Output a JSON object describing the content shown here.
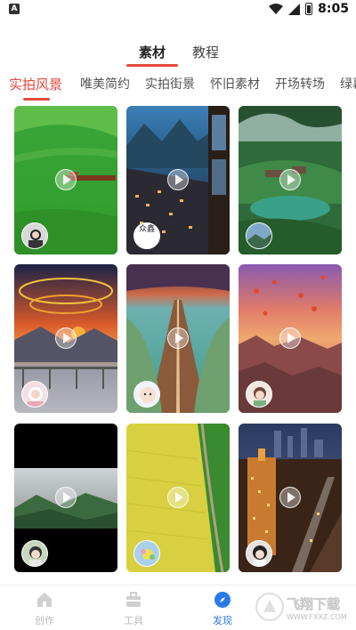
{
  "status": {
    "app_icon": "A",
    "time": "8:05"
  },
  "top_tabs": [
    {
      "label": "素材",
      "active": true
    },
    {
      "label": "教程",
      "active": false
    }
  ],
  "category_tabs": [
    {
      "label": "实拍风景",
      "active": true
    },
    {
      "label": "唯美简约"
    },
    {
      "label": "实拍街景"
    },
    {
      "label": "怀旧素材"
    },
    {
      "label": "开场转场"
    },
    {
      "label": "绿幕"
    }
  ],
  "cards": [
    {
      "thumb": "green-meadow-with-train",
      "avatar": "girl-portrait-avatar"
    },
    {
      "thumb": "mountain-town-night",
      "avatar_text": "众鑫"
    },
    {
      "thumb": "lush-valley-pools",
      "avatar": "small-landscape-avatar"
    },
    {
      "thumb": "sunset-swirl-sky",
      "avatar": "anime-girl-avatar"
    },
    {
      "thumb": "long-road-across-lake",
      "avatar": "cartoon-avatar"
    },
    {
      "thumb": "hot-air-balloons-canyon",
      "avatar": "cartoon-girl-avatar"
    },
    {
      "thumb": "misty-mountains-black-frame",
      "avatar": "woman-avatar"
    },
    {
      "thumb": "yellow-rapeseed-field",
      "avatar": "flower-avatar"
    },
    {
      "thumb": "city-night-bund",
      "avatar": "woman-portrait-avatar"
    }
  ],
  "bottom_nav": [
    {
      "label": "创作",
      "icon": "home-icon",
      "active": false
    },
    {
      "label": "工具",
      "icon": "toolbox-icon",
      "active": false
    },
    {
      "label": "发现",
      "icon": "compass-icon",
      "active": true
    }
  ],
  "watermark": {
    "text": "飞翔下载",
    "url": "WWW.FXXZ.COM"
  }
}
